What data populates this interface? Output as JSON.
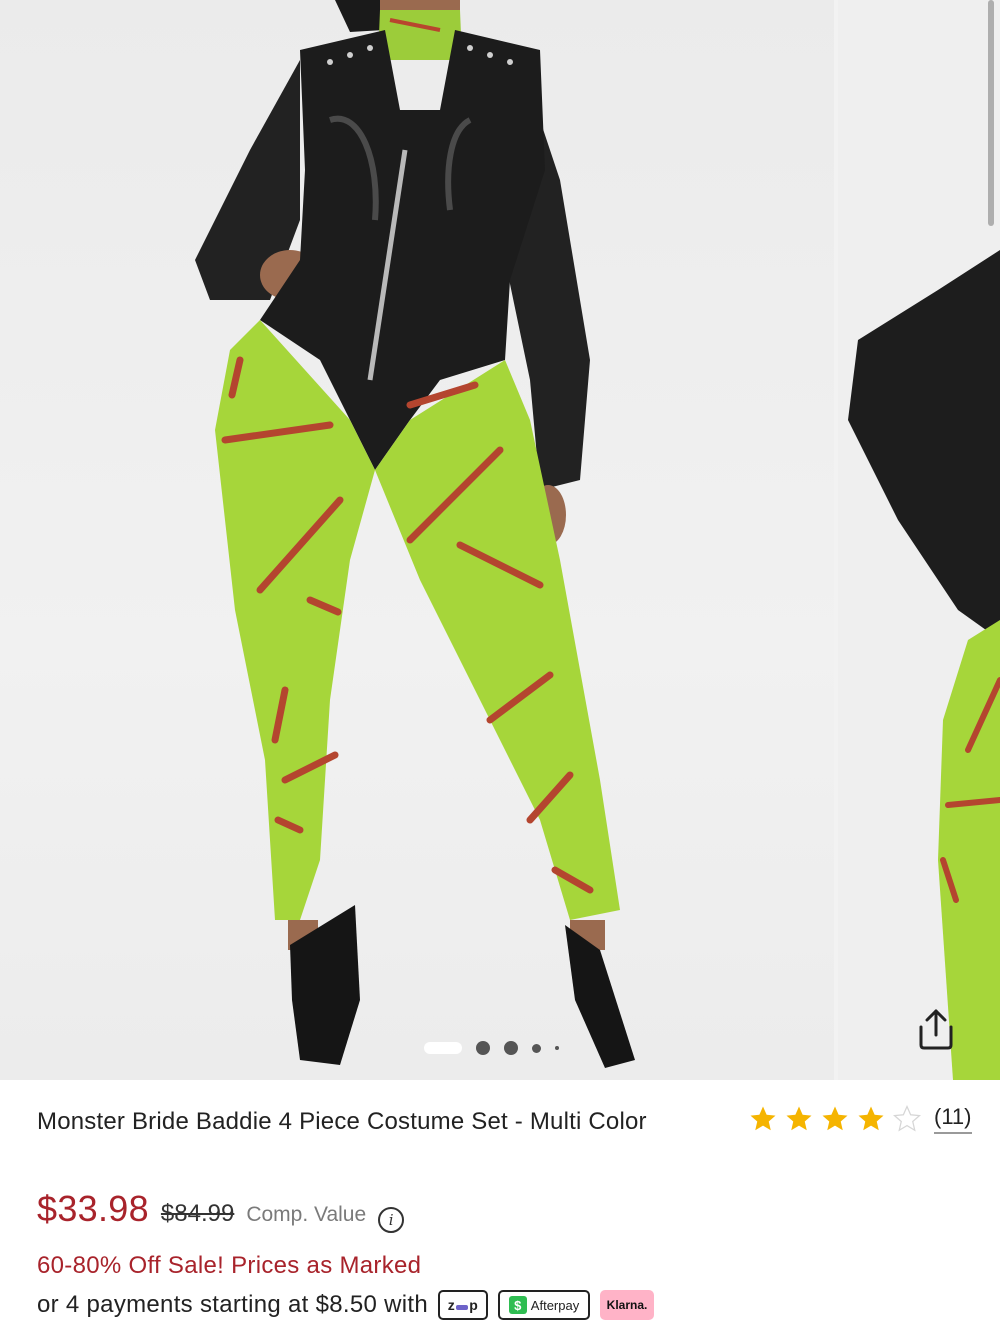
{
  "gallery": {
    "main_image_alt": "",
    "slide_count": 5,
    "active_slide": 1
  },
  "product": {
    "title": "Monster Bride Baddie 4 Piece Costume Set - Multi Color",
    "rating": {
      "stars": 4,
      "max": 5,
      "reviews_label": "(11)"
    },
    "price": {
      "sale": "$33.98",
      "original": "$84.99",
      "comp_label": "Comp. Value",
      "info_glyph": "i"
    },
    "promo": "60-80% Off Sale! Prices as Marked",
    "payments": {
      "text": "or 4 payments starting at $8.50 with",
      "zip_label": "zip",
      "afterpay_label": "Afterpay",
      "afterpay_glyph": "$",
      "klarna_label": "Klarna."
    }
  },
  "colors": {
    "sale_red": "#a8232b",
    "star_gold": "#f5b400",
    "legging_green": "#a6d63a",
    "bodysuit_black": "#1c1c1c",
    "klarna_pink": "#ffb3c7",
    "afterpay_green": "#2fbd52",
    "zip_purple": "#6e63c9"
  },
  "icons": {
    "share": "share-icon",
    "star_filled": "star-filled-icon",
    "star_empty": "star-empty-icon",
    "info": "info-icon"
  }
}
